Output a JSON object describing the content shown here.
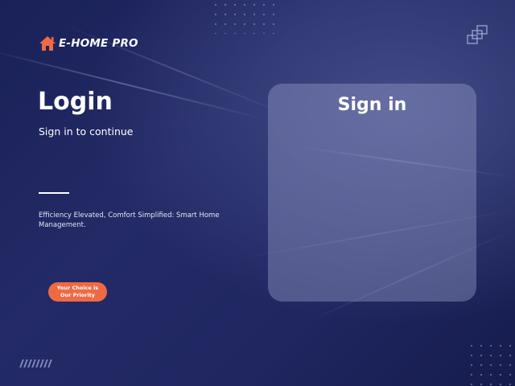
{
  "brand": {
    "name": "E-HOME PRO",
    "icon": "house-icon",
    "icon_color": "#ee6a44"
  },
  "login": {
    "title": "Login",
    "subtitle": "Sign in to continue",
    "tagline": "Efficiency Elevated, Comfort Simplified: Smart Home Management."
  },
  "badge": {
    "line1": "Your Choice is",
    "line2": "Our Priority",
    "color": "#ee6a44"
  },
  "signin_card": {
    "title": "Sign in"
  },
  "decor": {
    "corner_icon": "stacked-squares-icon",
    "hatch_icon": "diagonal-hatch-icon"
  },
  "colors": {
    "background": "#1f2660",
    "accent": "#ee6a44",
    "card": "rgba(150,158,200,0.42)"
  }
}
